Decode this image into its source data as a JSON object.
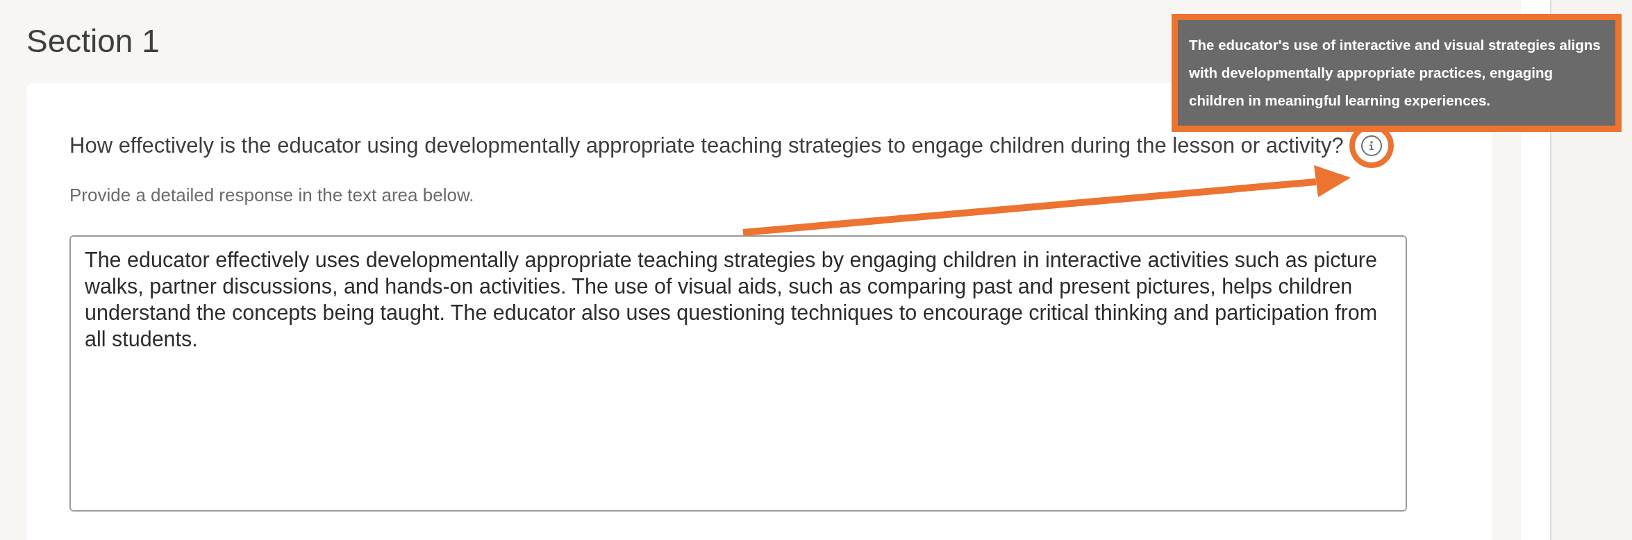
{
  "section": {
    "title": "Section 1"
  },
  "question": {
    "text": "How effectively is the educator using developmentally appropriate teaching strategies to engage children during the lesson or activity?",
    "hint": "Provide a detailed response in the text area below."
  },
  "response": {
    "value": "The educator effectively uses developmentally appropriate teaching strategies by engaging children in interactive activities such as picture walks, partner discussions, and hands-on activities. The use of visual aids, such as comparing past and present pictures, helps children understand the concepts being taught. The educator also uses questioning techniques to encourage critical thinking and participation from all students."
  },
  "tooltip": {
    "text": "The educator's use of interactive and visual strategies aligns with developmentally appropriate practices, engaging children in meaningful learning experiences."
  }
}
